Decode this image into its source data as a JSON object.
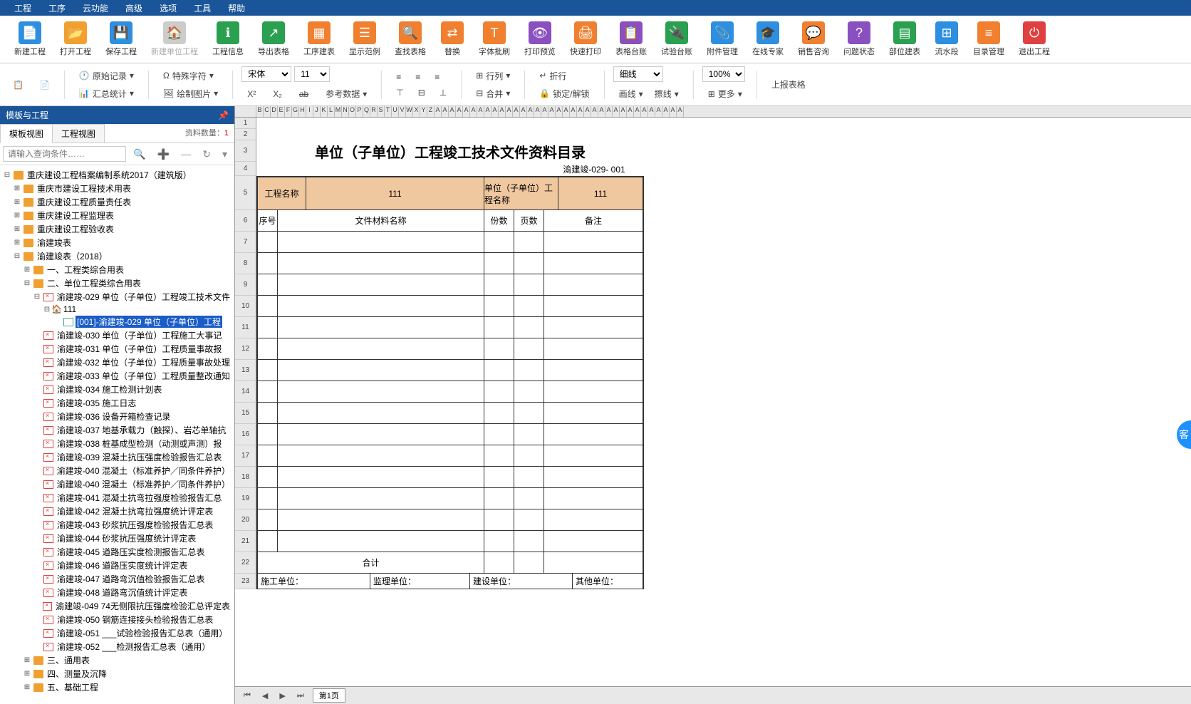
{
  "menubar": [
    "工程",
    "工序",
    "云功能",
    "高级",
    "选项",
    "工具",
    "帮助"
  ],
  "toolbar": [
    {
      "label": "新建工程",
      "color": "#2e8fe0",
      "glyph": "📄"
    },
    {
      "label": "打开工程",
      "color": "#f0a030",
      "glyph": "📂"
    },
    {
      "label": "保存工程",
      "color": "#2e8fe0",
      "glyph": "💾"
    },
    {
      "label": "新建单位工程",
      "color": "#ccc",
      "glyph": "🏠",
      "dim": true
    },
    {
      "label": "工程信息",
      "color": "#2aa050",
      "glyph": "ℹ"
    },
    {
      "label": "导出表格",
      "color": "#2aa050",
      "glyph": "↗"
    },
    {
      "label": "工序建表",
      "color": "#f08030",
      "glyph": "▦"
    },
    {
      "label": "显示范例",
      "color": "#f08030",
      "glyph": "☰"
    },
    {
      "label": "查找表格",
      "color": "#f08030",
      "glyph": "🔍"
    },
    {
      "label": "替换",
      "color": "#f08030",
      "glyph": "⇄"
    },
    {
      "label": "字体批刷",
      "color": "#f08030",
      "glyph": "T"
    },
    {
      "label": "打印预览",
      "color": "#8a50c0",
      "glyph": "👁"
    },
    {
      "label": "快速打印",
      "color": "#f08030",
      "glyph": "🖨"
    },
    {
      "label": "表格台账",
      "color": "#8a50c0",
      "glyph": "📋"
    },
    {
      "label": "试验台账",
      "color": "#2aa050",
      "glyph": "🔌"
    },
    {
      "label": "附件管理",
      "color": "#2e8fe0",
      "glyph": "📎"
    },
    {
      "label": "在线专家",
      "color": "#2e8fe0",
      "glyph": "🎓"
    },
    {
      "label": "销售咨询",
      "color": "#f08030",
      "glyph": "💬"
    },
    {
      "label": "问题状态",
      "color": "#8a50c0",
      "glyph": "?"
    },
    {
      "label": "部位建表",
      "color": "#2aa050",
      "glyph": "▤"
    },
    {
      "label": "流水段",
      "color": "#2e8fe0",
      "glyph": "⊞"
    },
    {
      "label": "目录管理",
      "color": "#f08030",
      "glyph": "≡"
    },
    {
      "label": "退出工程",
      "color": "#e04040",
      "glyph": "⏻"
    }
  ],
  "ribbon": {
    "raw_record": "原始记录",
    "sum_stat": "汇总统计",
    "special_char": "特殊字符",
    "draw_pic": "绘制图片",
    "ref_data": "参考数据",
    "font": "宋体",
    "font_size": "11",
    "row_col": "行列",
    "merge": "合并",
    "wrap": "折行",
    "lock": "锁定/解锁",
    "line_style": "细线",
    "line_color": "画线",
    "erase_line": "擦线",
    "zoom": "100%",
    "more": "更多",
    "upload": "上报表格"
  },
  "left_panel": {
    "header": "模板与工程",
    "tabs": [
      "模板视图",
      "工程视图"
    ],
    "count_label": "资料数量：",
    "count": "1",
    "search_placeholder": "请输入查询条件……",
    "root": "重庆建设工程档案编制系统2017（建筑版）",
    "nodes": [
      "重庆市建设工程技术用表",
      "重庆建设工程质量责任表",
      "重庆建设工程监理表",
      "重庆建设工程验收表",
      "渝建竣表",
      "渝建竣表（2018）"
    ],
    "subnodes": [
      "一、工程类综合用表",
      "二、单位工程类综合用表"
    ],
    "item_parent": "渝建竣-029 单位（子单位）工程竣工技术文件",
    "item_111": "111",
    "item_selected": "[001]-渝建竣-029 单位（子单位）工程",
    "items": [
      "渝建竣-030 单位（子单位）工程施工大事记",
      "渝建竣-031 单位（子单位）工程质量事故报",
      "渝建竣-032 单位（子单位）工程质量事故处理",
      "渝建竣-033 单位（子单位）工程质量整改通知",
      "渝建竣-034 施工检测计划表",
      "渝建竣-035 施工日志",
      "渝建竣-036 设备开箱检查记录",
      "渝建竣-037 地基承载力（触探）、岩芯单轴抗",
      "渝建竣-038 桩基成型检测（动测或声测）报",
      "渝建竣-039 混凝土抗压强度检验报告汇总表",
      "渝建竣-040 混凝土（标准养护／同条件养护）",
      "渝建竣-040 混凝土（标准养护／同条件养护）",
      "渝建竣-041 混凝土抗弯拉强度检验报告汇总",
      "渝建竣-042 混凝土抗弯拉强度统计评定表",
      "渝建竣-043 砂浆抗压强度检验报告汇总表",
      "渝建竣-044 砂浆抗压强度统计评定表",
      "渝建竣-045 道路压实度检测报告汇总表",
      "渝建竣-046 道路压实度统计评定表",
      "渝建竣-047 道路弯沉值检验报告汇总表",
      "渝建竣-048 道路弯沉值统计评定表",
      "渝建竣-049 74无侧限抗压强度检验汇总评定表",
      "渝建竣-050 钢筋连接接头检验报告汇总表",
      "渝建竣-051 ___试验检验报告汇总表（通用）",
      "渝建竣-052 ___检测报告汇总表（通用）"
    ],
    "tail": [
      "三、通用表",
      "四、测量及沉降",
      "五、基础工程"
    ]
  },
  "sheet": {
    "title": "单位（子单位）工程竣工技术文件资料目录",
    "doc_no": "渝建竣-029- 001",
    "headers": {
      "proj_name_lbl": "工程名称",
      "proj_name_val": "111",
      "unit_name_lbl": "单位（子单位）工程名称",
      "unit_name_val": "111",
      "seq": "序号",
      "file_name": "文件材料名称",
      "copies": "份数",
      "pages": "页数",
      "remark": "备注",
      "total": "合计",
      "constr_unit": "施工单位：",
      "super_unit": "监理单位：",
      "build_unit": "建设单位：",
      "other_unit": "其他单位："
    },
    "page_label": "第1页"
  },
  "help_bubble": "客"
}
